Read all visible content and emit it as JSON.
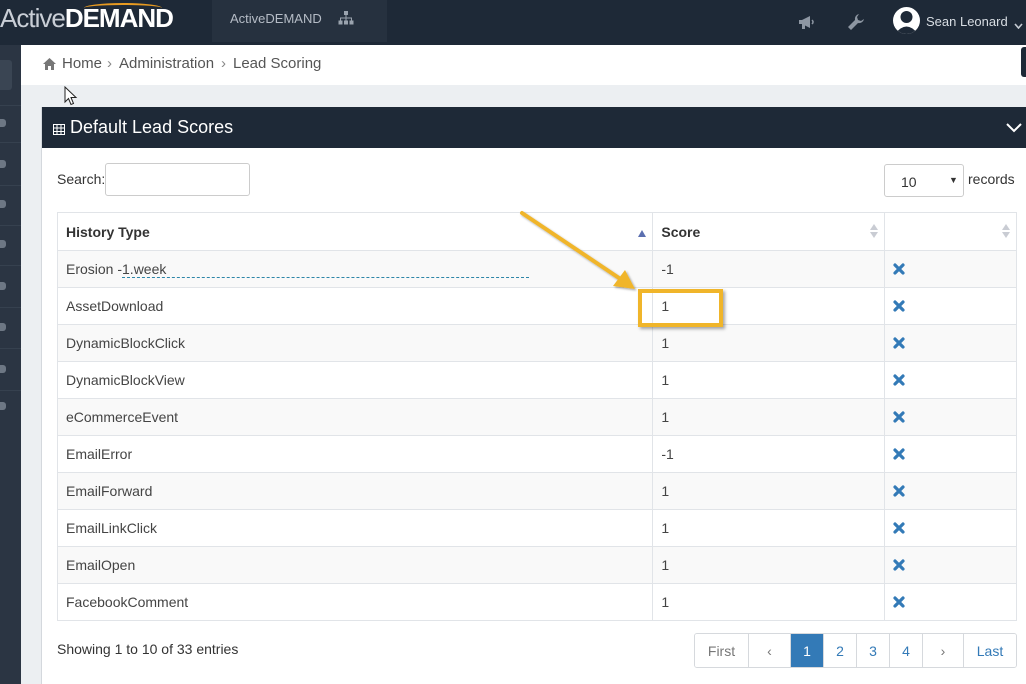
{
  "header": {
    "logo_part1": "Active",
    "logo_part2": "DEMAND",
    "app_name": "ActiveDEMAND",
    "user_name": "Sean Leonard",
    "icons": [
      "megaphone-icon",
      "wrench-icon",
      "user-avatar-icon",
      "caret-down-icon",
      "sitemap-icon"
    ]
  },
  "breadcrumb": {
    "home": "Home",
    "items": [
      "Administration",
      "Lead Scoring"
    ],
    "separator": "›"
  },
  "panel": {
    "title": "Default Lead Scores"
  },
  "controls": {
    "search_label": "Search:",
    "search_value": "",
    "page_length": "10",
    "records_label": "records"
  },
  "table": {
    "headers": [
      "History Type",
      "Score",
      ""
    ],
    "rows": [
      {
        "type": "Erosion -1.week",
        "score": "-1"
      },
      {
        "type": "AssetDownload",
        "score": "1"
      },
      {
        "type": "DynamicBlockClick",
        "score": "1"
      },
      {
        "type": "DynamicBlockView",
        "score": "1"
      },
      {
        "type": "eCommerceEvent",
        "score": "1"
      },
      {
        "type": "EmailError",
        "score": "-1"
      },
      {
        "type": "EmailForward",
        "score": "1"
      },
      {
        "type": "EmailLinkClick",
        "score": "1"
      },
      {
        "type": "EmailOpen",
        "score": "1"
      },
      {
        "type": "FacebookComment",
        "score": "1"
      }
    ]
  },
  "footer": {
    "info": "Showing 1 to 10 of 33 entries",
    "pagination": {
      "first": "First",
      "prev": "‹",
      "pages": [
        "1",
        "2",
        "3",
        "4"
      ],
      "active_page": "1",
      "next": "›",
      "last": "Last"
    }
  },
  "colors": {
    "navbar": "#1e2937",
    "accent": "#337ab7",
    "highlight": "#f0b52a",
    "logo_orange": "#e79a21"
  }
}
